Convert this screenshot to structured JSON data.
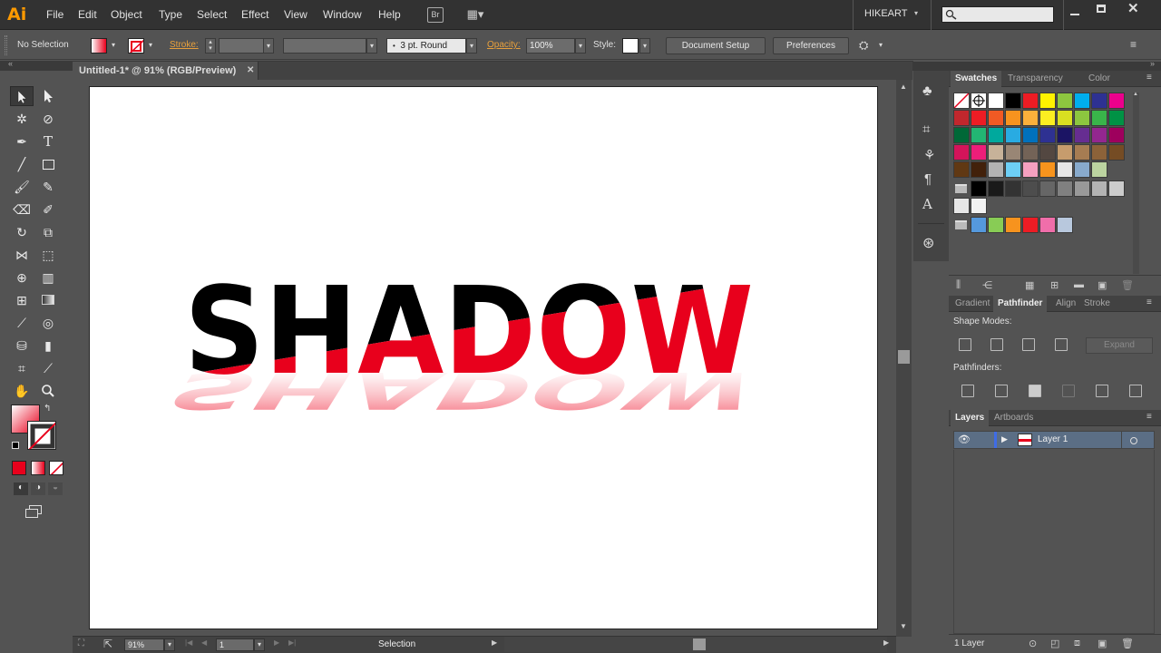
{
  "app": {
    "logo": "Ai",
    "workspace": "HIKEART"
  },
  "menu": [
    "File",
    "Edit",
    "Object",
    "Type",
    "Select",
    "Effect",
    "View",
    "Window",
    "Help"
  ],
  "menu_buttons": {
    "bridge": "Br",
    "arrange": "▦▾"
  },
  "control_bar": {
    "selection_label": "No Selection",
    "stroke_label": "Stroke:",
    "brush_value": "3 pt. Round",
    "opacity_label": "Opacity:",
    "opacity_value": "100%",
    "style_label": "Style:",
    "document_setup": "Document Setup",
    "preferences": "Preferences"
  },
  "document": {
    "tab_title": "Untitled-1* @ 91% (RGB/Preview)",
    "close": "✕"
  },
  "artwork": {
    "text": "SHADOW",
    "black": "#000000",
    "red": "#e8001c"
  },
  "status": {
    "zoom": "91%",
    "artboard_number": "1",
    "tool_name": "Selection"
  },
  "swatches_panel": {
    "tabs": [
      "Swatches",
      "Transparency",
      "Color"
    ],
    "rows": [
      [
        "#ffffff",
        "#000000",
        "#ed1c24",
        "#fff200",
        "#8dc63f",
        "#00aeef",
        "#2e3192",
        "#ec008c"
      ],
      [
        "#c1272d",
        "#ed1c24",
        "#f15a24",
        "#f7931e",
        "#fbb03b",
        "#fcee21",
        "#d9e021",
        "#8cc63f",
        "#39b54a",
        "#009245"
      ],
      [
        "#006837",
        "#22b573",
        "#00a99d",
        "#29abe2",
        "#0071bc",
        "#2e3192",
        "#1b1464",
        "#662d91",
        "#93278f",
        "#9e005d"
      ],
      [
        "#d4145a",
        "#ed1e79",
        "#c7b299",
        "#998675",
        "#736357",
        "#534741",
        "#c69c6d",
        "#a67c52",
        "#8c6239",
        "#754c24"
      ],
      [
        "#603813",
        "#42210b",
        "#b3b3b3",
        "#6dcff6",
        "#f5a0c0",
        "#f7941d",
        "#e6e6e6",
        "#88aacc",
        "#bcd4a0"
      ],
      [
        "#000000",
        "#1a1a1a",
        "#333333",
        "#4d4d4d",
        "#666666",
        "#808080",
        "#999999",
        "#b3b3b3",
        "#cccccc"
      ],
      [
        "#e6e6e6",
        "#f2f2f2"
      ],
      [
        "#5599dd",
        "#88cc55",
        "#f7931e",
        "#ed1c24",
        "#f06eaa",
        "#b8c8dd"
      ]
    ]
  },
  "pathfinder_panel": {
    "tabs": [
      "Gradient",
      "Pathfinder",
      "Align",
      "Stroke"
    ],
    "shape_modes": "Shape Modes:",
    "expand": "Expand",
    "pathfinders": "Pathfinders:"
  },
  "layers_panel": {
    "tabs": [
      "Layers",
      "Artboards"
    ],
    "layer_name": "Layer 1",
    "footer": "1 Layer"
  }
}
